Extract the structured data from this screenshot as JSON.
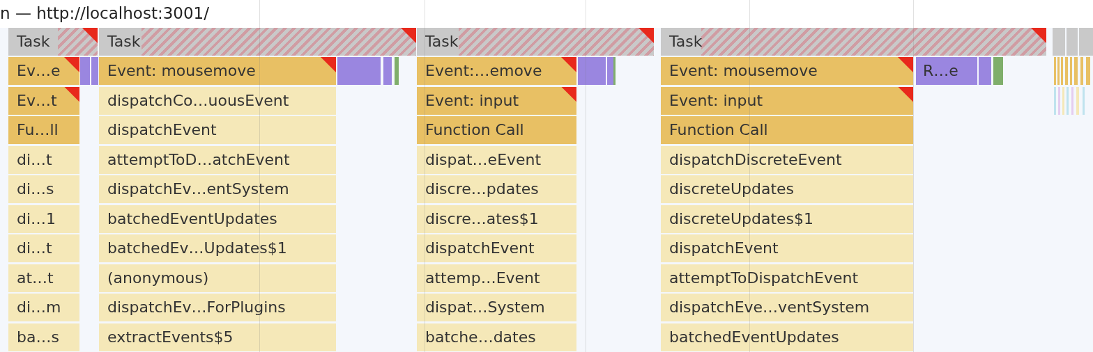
{
  "title": "n — http://localhost:3001/",
  "stacks": [
    {
      "task": {
        "label": "Task",
        "warning": true,
        "long": true
      },
      "entries": [
        {
          "label": "Ev…e",
          "kind": "event",
          "warning": true
        },
        {
          "label": "Ev…t",
          "kind": "event",
          "warning": true
        },
        {
          "label": "Fu…ll",
          "kind": "event",
          "warning": false
        },
        {
          "label": "di…t",
          "kind": "script",
          "warning": false
        },
        {
          "label": "di…s",
          "kind": "script",
          "warning": false
        },
        {
          "label": "di…1",
          "kind": "script",
          "warning": false
        },
        {
          "label": "di…t",
          "kind": "script",
          "warning": false
        },
        {
          "label": "at…t",
          "kind": "script",
          "warning": false
        },
        {
          "label": "di…m",
          "kind": "script",
          "warning": false
        },
        {
          "label": "ba…s",
          "kind": "script",
          "warning": false
        }
      ],
      "side": [
        {
          "kind": "render"
        },
        {
          "kind": "render"
        }
      ]
    },
    {
      "task": {
        "label": "Task",
        "warning": true,
        "long": true
      },
      "entries": [
        {
          "label": "Event: mousemove",
          "kind": "event",
          "warning": true
        },
        {
          "label": "dispatchCo…uousEvent",
          "kind": "script",
          "warning": false
        },
        {
          "label": "dispatchEvent",
          "kind": "script",
          "warning": false
        },
        {
          "label": "attemptToD…atchEvent",
          "kind": "script",
          "warning": false
        },
        {
          "label": "dispatchEv…entSystem",
          "kind": "script",
          "warning": false
        },
        {
          "label": "batchedEventUpdates",
          "kind": "script",
          "warning": false
        },
        {
          "label": "batchedEv…Updates$1",
          "kind": "script",
          "warning": false
        },
        {
          "label": "(anonymous)",
          "kind": "script",
          "warning": false
        },
        {
          "label": "dispatchEv…ForPlugins",
          "kind": "script",
          "warning": false
        },
        {
          "label": "extractEvents$5",
          "kind": "script",
          "warning": false
        }
      ],
      "side": [
        {
          "kind": "render"
        },
        {
          "kind": "render"
        },
        {
          "kind": "paint"
        }
      ]
    },
    {
      "task": {
        "label": "Task",
        "warning": true,
        "long": true
      },
      "entries": [
        {
          "label": "Event:…emove",
          "kind": "event",
          "warning": true
        },
        {
          "label": "Event: input",
          "kind": "event",
          "warning": true
        },
        {
          "label": "Function Call",
          "kind": "event",
          "warning": false
        },
        {
          "label": "dispat…eEvent",
          "kind": "script",
          "warning": false
        },
        {
          "label": "discre…pdates",
          "kind": "script",
          "warning": false
        },
        {
          "label": "discre…ates$1",
          "kind": "script",
          "warning": false
        },
        {
          "label": "dispatchEvent",
          "kind": "script",
          "warning": false
        },
        {
          "label": "attemp…Event",
          "kind": "script",
          "warning": false
        },
        {
          "label": "dispat…System",
          "kind": "script",
          "warning": false
        },
        {
          "label": "batche…dates",
          "kind": "script",
          "warning": false
        }
      ],
      "side": [
        {
          "kind": "render"
        },
        {
          "kind": "render"
        },
        {
          "kind": "paint"
        }
      ]
    },
    {
      "task": {
        "label": "Task",
        "warning": true,
        "long": true
      },
      "entries": [
        {
          "label": "Event: mousemove",
          "kind": "event",
          "warning": true
        },
        {
          "label": "Event: input",
          "kind": "event",
          "warning": true
        },
        {
          "label": "Function Call",
          "kind": "event",
          "warning": false
        },
        {
          "label": "dispatchDiscreteEvent",
          "kind": "script",
          "warning": false
        },
        {
          "label": "discreteUpdates",
          "kind": "script",
          "warning": false
        },
        {
          "label": "discreteUpdates$1",
          "kind": "script",
          "warning": false
        },
        {
          "label": "dispatchEvent",
          "kind": "script",
          "warning": false
        },
        {
          "label": "attemptToDispatchEvent",
          "kind": "script",
          "warning": false
        },
        {
          "label": "dispatchEve…ventSystem",
          "kind": "script",
          "warning": false
        },
        {
          "label": "batchedEventUpdates",
          "kind": "script",
          "warning": false
        }
      ],
      "side": [
        {
          "kind": "render",
          "label": "R…e"
        },
        {
          "kind": "render"
        },
        {
          "kind": "paint"
        }
      ]
    }
  ]
}
